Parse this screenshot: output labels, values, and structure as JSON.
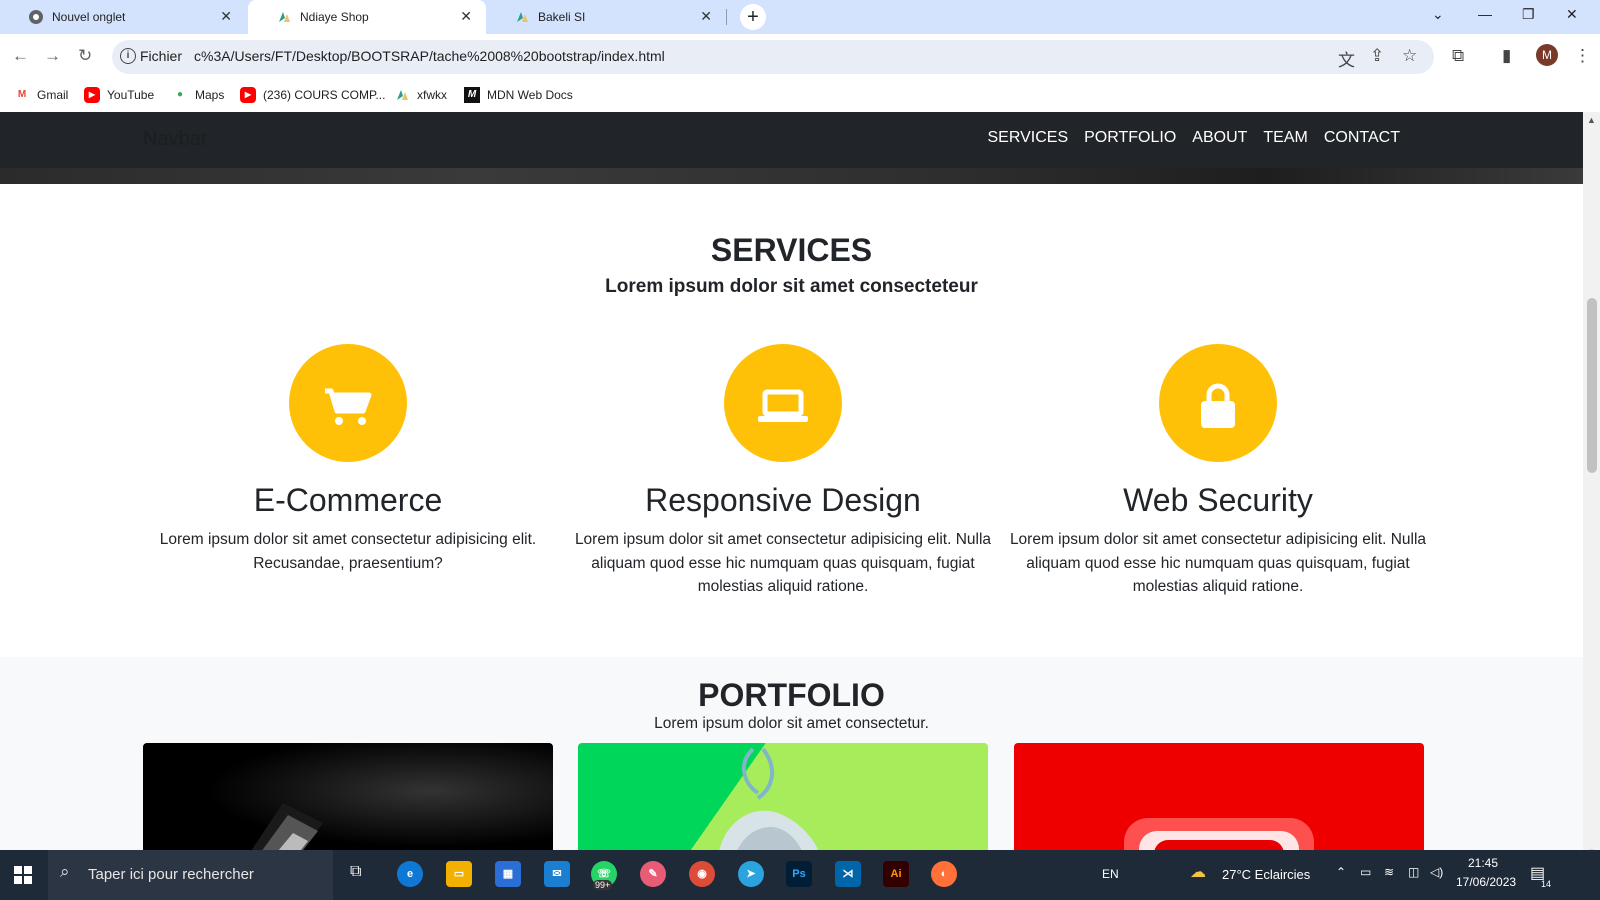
{
  "browser": {
    "tabs": [
      {
        "title": "Nouvel onglet"
      },
      {
        "title": "Ndiaye Shop"
      },
      {
        "title": "Bakeli SI"
      }
    ],
    "address": {
      "chip": "Fichier",
      "url": "c%3A/Users/FT/Desktop/BOOTSRAP/tache%2008%20bootstrap/index.html"
    },
    "profile_initial": "M",
    "bookmarks": [
      {
        "label": "Gmail",
        "icon": "gmail-icon"
      },
      {
        "label": "YouTube",
        "icon": "youtube-icon"
      },
      {
        "label": "Maps",
        "icon": "maps-icon"
      },
      {
        "label": "(236) COURS COMP...",
        "icon": "youtube-icon"
      },
      {
        "label": "xfwkx",
        "icon": "site-icon"
      },
      {
        "label": "MDN Web Docs",
        "icon": "mdn-icon"
      }
    ]
  },
  "site": {
    "brand": "Navbar",
    "nav": [
      "SERVICES",
      "PORTFOLIO",
      "ABOUT",
      "TEAM",
      "CONTACT"
    ],
    "services": {
      "title": "SERVICES",
      "subtitle": "Lorem ipsum dolor sit amet consecteteur",
      "items": [
        {
          "icon": "cart-icon",
          "title": "E-Commerce",
          "text": "Lorem ipsum dolor sit amet consectetur adipisicing elit. Recusandae, praesentium?"
        },
        {
          "icon": "laptop-icon",
          "title": "Responsive Design",
          "text": "Lorem ipsum dolor sit amet consectetur adipisicing elit. Nulla aliquam quod esse hic numquam quas quisquam, fugiat molestias aliquid ratione."
        },
        {
          "icon": "lock-icon",
          "title": "Web Security",
          "text": "Lorem ipsum dolor sit amet consectetur adipisicing elit. Nulla aliquam quod esse hic numquam quas quisquam, fugiat molestias aliquid ratione."
        }
      ],
      "accent": "#ffc107"
    },
    "portfolio": {
      "title": "PORTFOLIO",
      "subtitle": "Lorem ipsum dolor sit amet consectetur."
    }
  },
  "taskbar": {
    "search_placeholder": "Taper ici pour rechercher",
    "lang": "EN",
    "weather": "27°C  Eclaircies",
    "time": "21:45",
    "date": "17/06/2023",
    "whatsapp_badge": "99+",
    "notification_count": "14"
  }
}
